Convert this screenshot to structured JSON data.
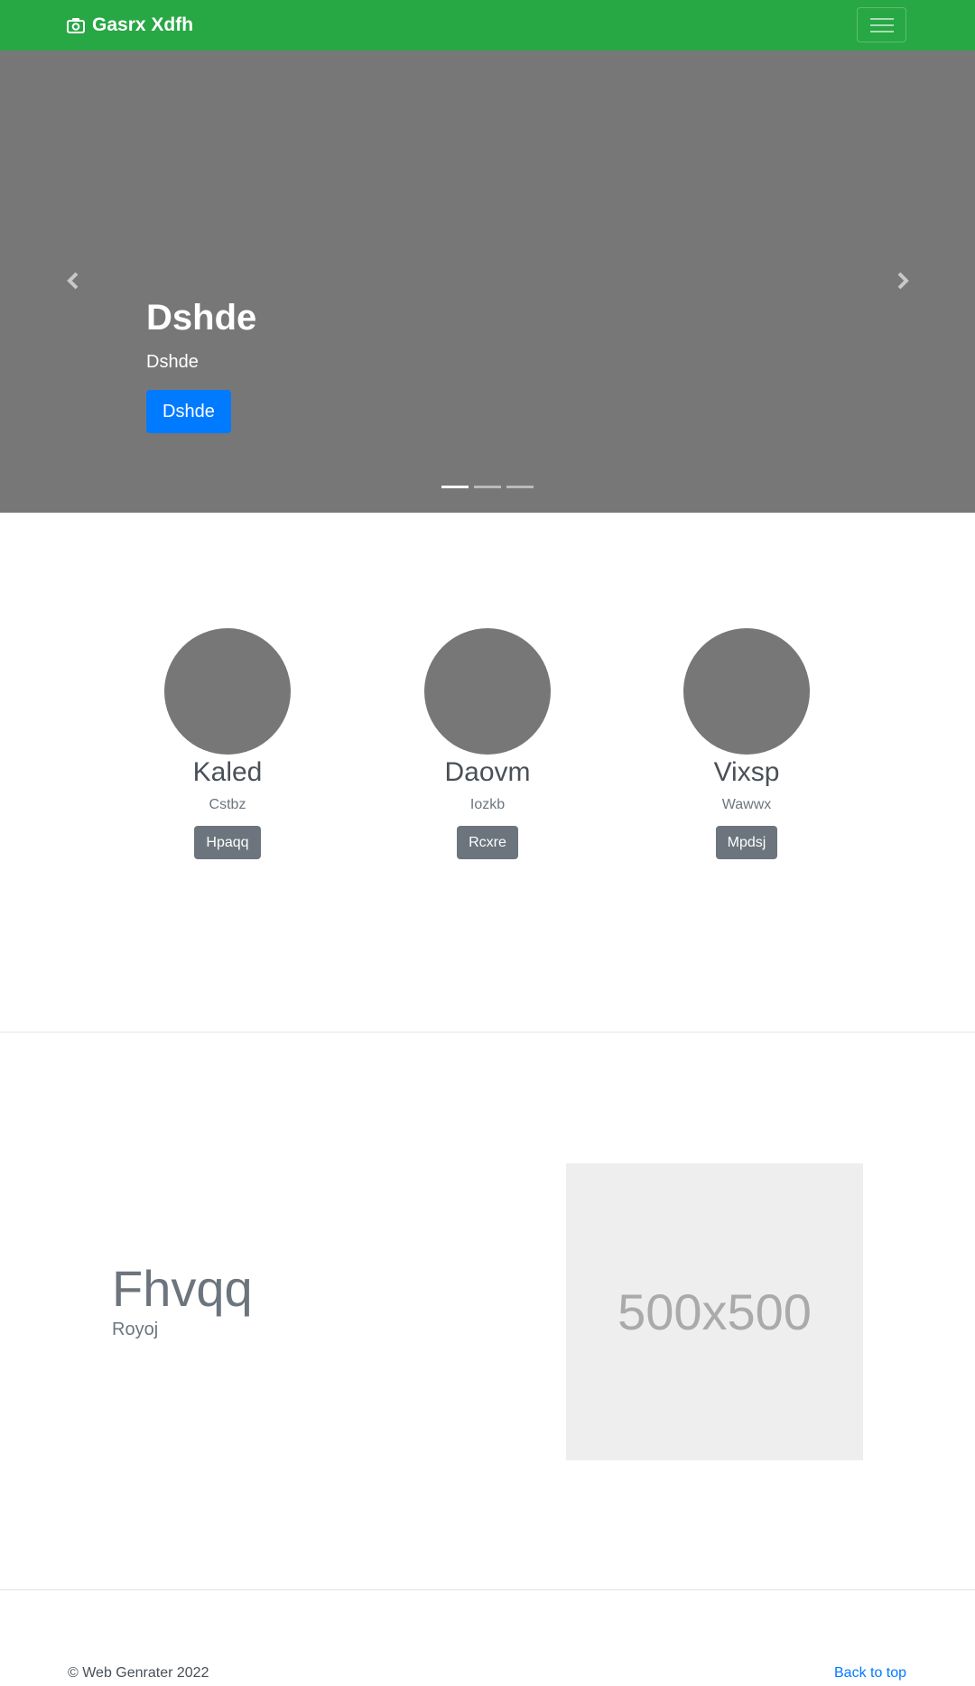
{
  "navbar": {
    "brand": "Gasrx Xdfh"
  },
  "hero": {
    "title": "Dshde",
    "text": "Dshde",
    "button": "Dshde",
    "slides": 3,
    "active_slide": 1
  },
  "people": [
    {
      "name": "Kaled",
      "subtitle": "Cstbz",
      "button": "Hpaqq"
    },
    {
      "name": "Daovm",
      "subtitle": "Iozkb",
      "button": "Rcxre"
    },
    {
      "name": "Vixsp",
      "subtitle": "Wawwx",
      "button": "Mpdsj"
    }
  ],
  "feature": {
    "heading": "Fhvqq",
    "subheading": "Royoj",
    "image_label": "500x500"
  },
  "footer": {
    "copyright": "© Web Genrater 2022",
    "back_to_top": "Back to top"
  }
}
